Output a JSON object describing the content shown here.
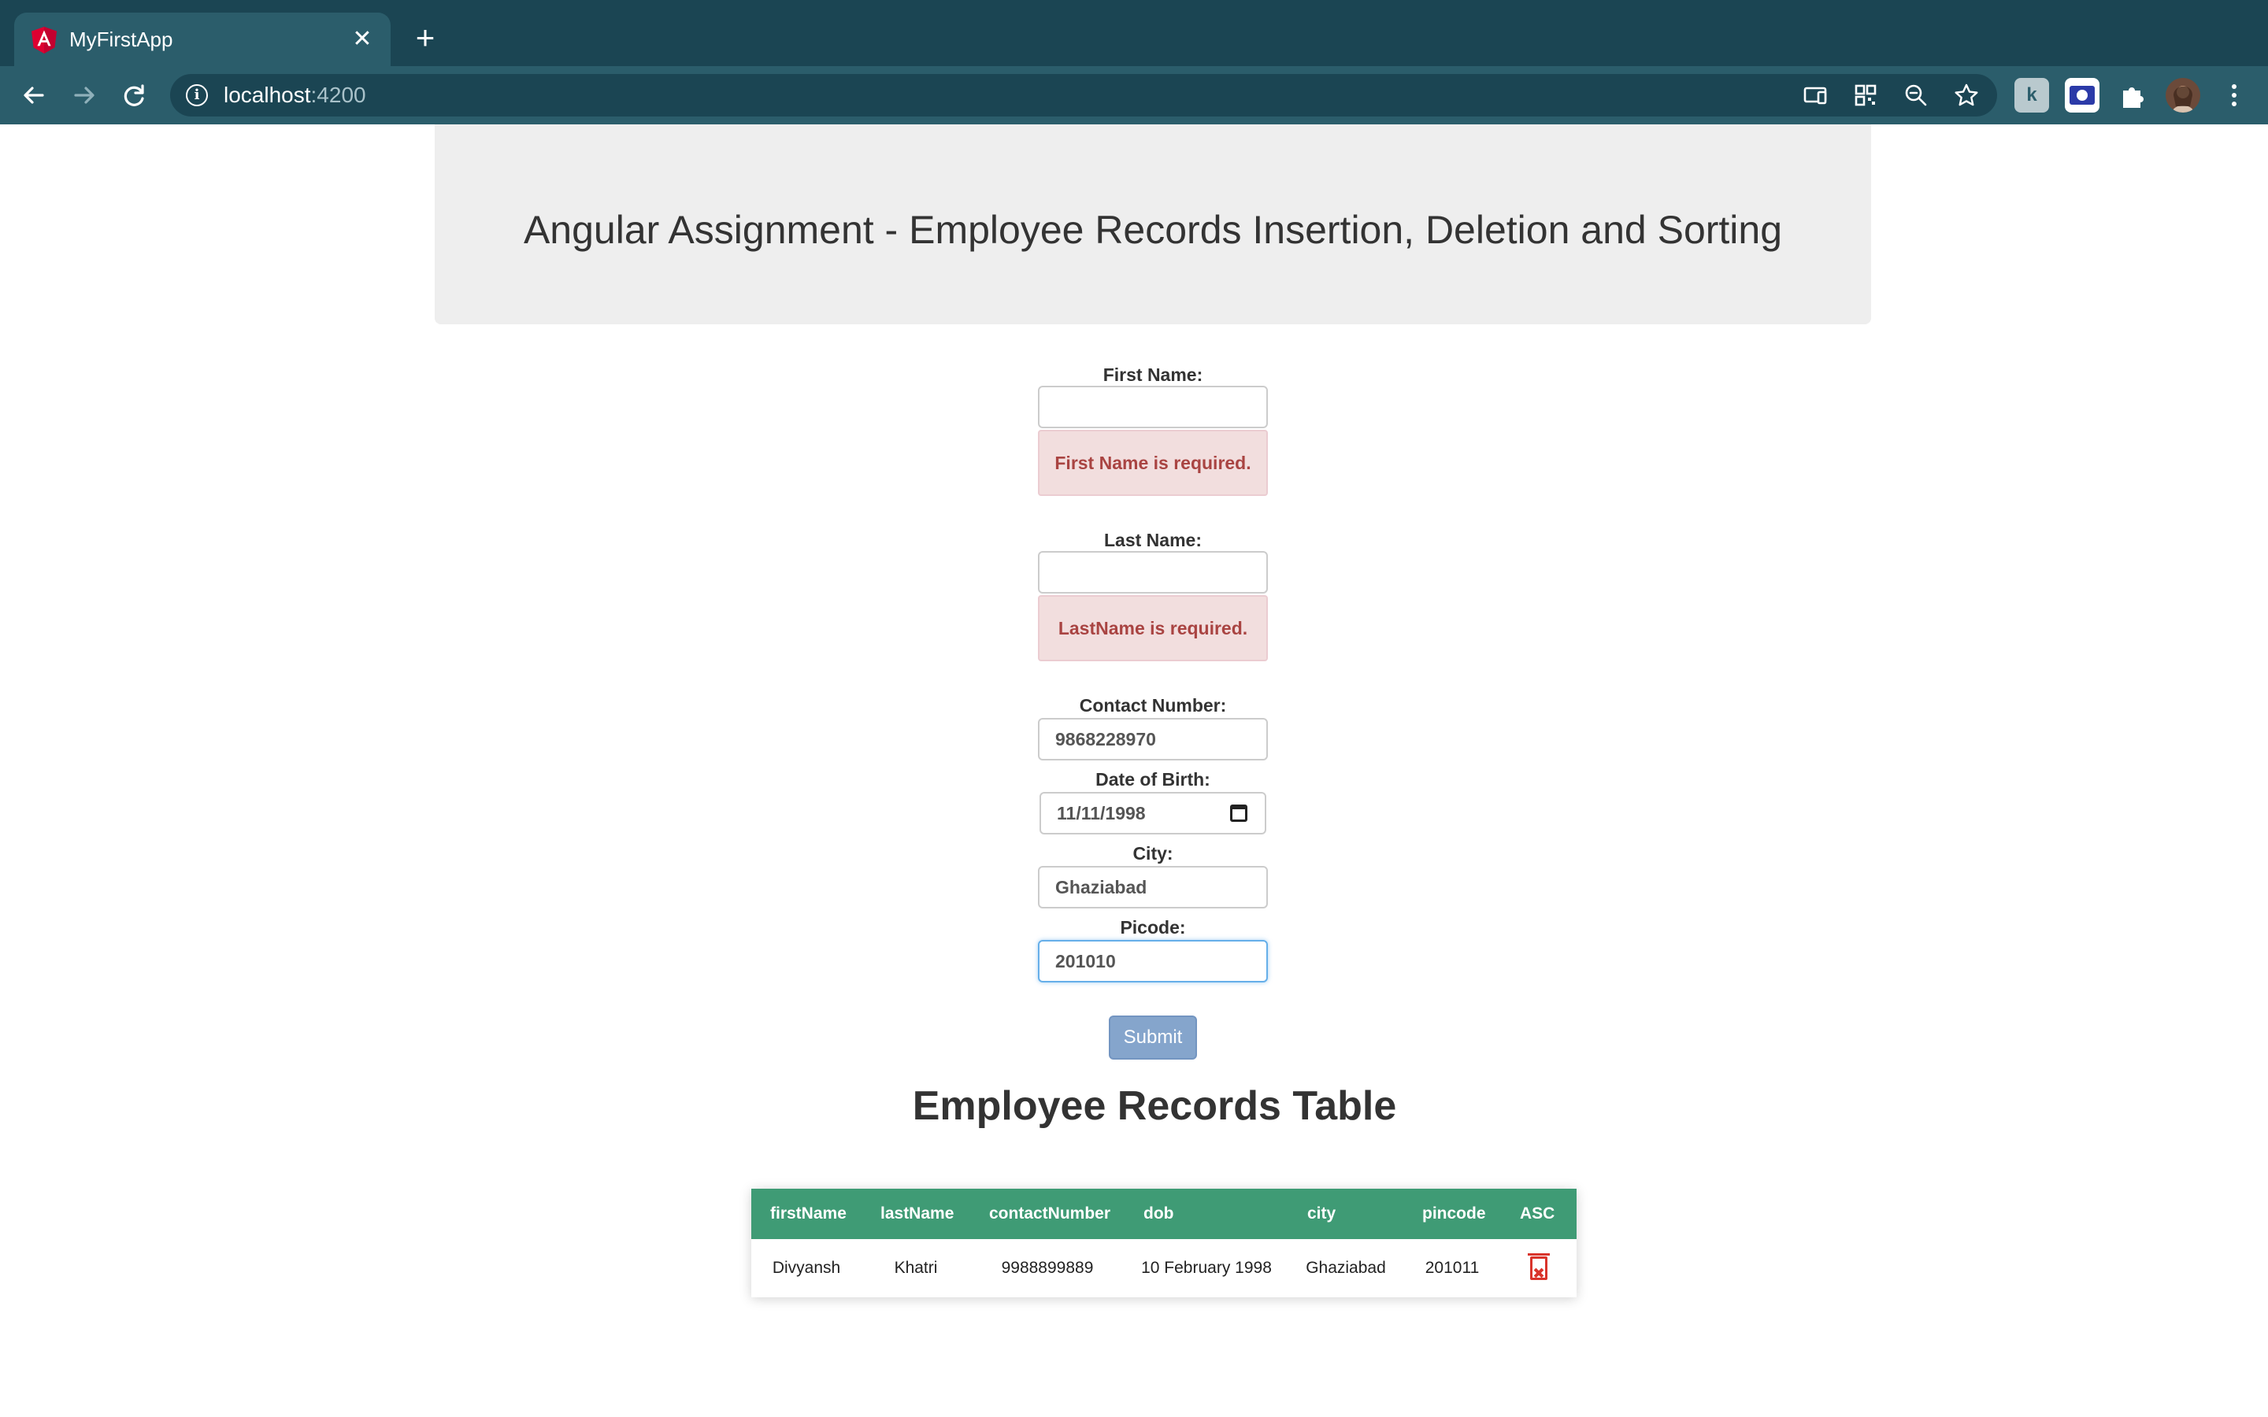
{
  "browser": {
    "tab_title": "MyFirstApp",
    "tab_close": "✕",
    "new_tab": "+",
    "url_host": "localhost",
    "url_port": ":4200",
    "toolbar_icons": [
      "back-icon",
      "forward-icon",
      "reload-icon",
      "info-icon",
      "cast-icon",
      "qr-code-icon",
      "zoom-icon",
      "star-icon",
      "extension-icon",
      "extension-icon",
      "puzzle-icon",
      "avatar",
      "menu-icon"
    ]
  },
  "page": {
    "title": "Angular Assignment - Employee Records Insertion, Deletion and Sorting"
  },
  "form": {
    "first_name": {
      "label": "First Name:",
      "value": "",
      "error": "First Name is required."
    },
    "last_name": {
      "label": "Last Name:",
      "value": "",
      "error": "LastName is required."
    },
    "contact_number": {
      "label": "Contact Number:",
      "value": "9868228970"
    },
    "dob": {
      "label": "Date of Birth:",
      "value": "11/11/1998"
    },
    "city": {
      "label": "City:",
      "value": "Ghaziabad"
    },
    "pincode": {
      "label": "Picode:",
      "value": "201010"
    },
    "submit_label": "Submit"
  },
  "table": {
    "title": "Employee Records Table",
    "headers": [
      "firstName",
      "lastName",
      "contactNumber",
      "dob",
      "city",
      "pincode",
      "ASC"
    ],
    "rows": [
      [
        "Divyansh",
        "Khatri",
        "9988899889",
        "10 February 1998",
        "Ghaziabad",
        "201011"
      ]
    ]
  },
  "colors": {
    "tabstrip": "#1b4553",
    "toolbar": "#2b5d6b",
    "table_header": "#3f9b75",
    "alert_bg": "#f2dede",
    "alert_text": "#a94442",
    "submit_bg": "#85a5cc",
    "delete_icon": "#d9342b"
  }
}
